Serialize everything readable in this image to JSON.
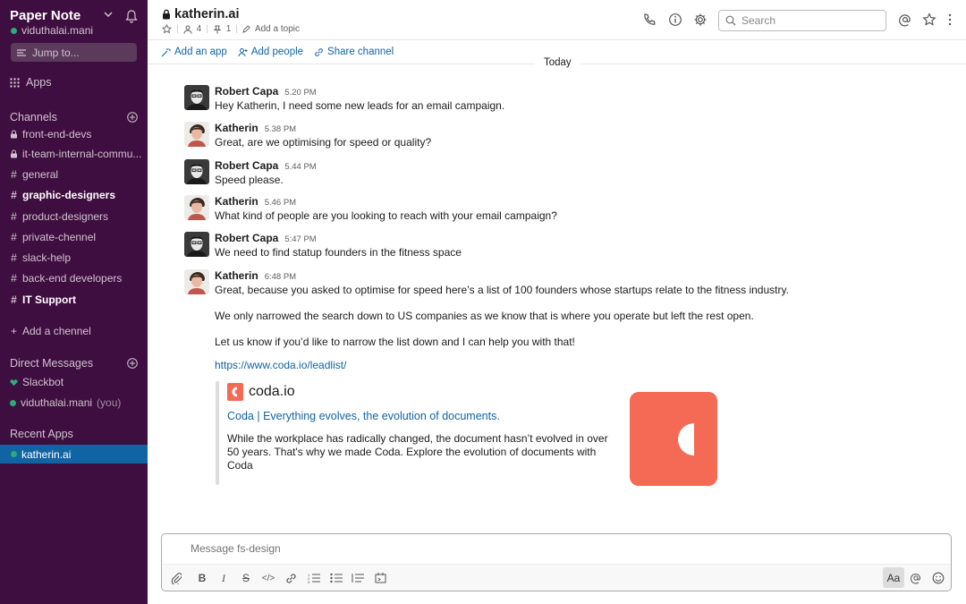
{
  "workspace": {
    "name": "Paper Note",
    "user": "viduthalai.mani"
  },
  "sidebar": {
    "jump_to": "Jump to...",
    "apps": "Apps",
    "channels_header": "Channels",
    "channels": [
      {
        "label": "front-end-devs",
        "locked": true,
        "bold": false
      },
      {
        "label": "it-team-internal-commu...",
        "locked": true,
        "bold": false
      },
      {
        "label": "general",
        "locked": false,
        "bold": false
      },
      {
        "label": "graphic-designers",
        "locked": false,
        "bold": true
      },
      {
        "label": "product-designers",
        "locked": false,
        "bold": false
      },
      {
        "label": "private-chennel",
        "locked": false,
        "bold": false
      },
      {
        "label": "slack-help",
        "locked": false,
        "bold": false
      },
      {
        "label": "back-end developers",
        "locked": false,
        "bold": false
      },
      {
        "label": "IT Support",
        "locked": false,
        "bold": true
      }
    ],
    "add_channel": "Add a chennel",
    "dm_header": "Direct Messages",
    "dms": [
      {
        "label": "Slackbot"
      },
      {
        "label": "viduthalai.mani",
        "suffix": "(you)"
      }
    ],
    "recent_apps_header": "Recent Apps",
    "recent_app": "katherin.ai"
  },
  "header": {
    "channel": "katherin.ai",
    "members": "4",
    "pins": "1",
    "topic": "Add a topic",
    "search_placeholder": "Search"
  },
  "subbar": {
    "add_app": "Add an app",
    "add_people": "Add people",
    "share": "Share channel"
  },
  "day_divider": "Today",
  "messages": [
    {
      "author": "Robert Capa",
      "time": "5.20 PM",
      "text": "Hey Katherin, I need some new leads  for an email campaign."
    },
    {
      "author": "Katherin",
      "time": "5.38 PM",
      "text": "Great, are we optimising for speed or quality?"
    },
    {
      "author": "Robert Capa",
      "time": "5.44 PM",
      "text": "Speed please."
    },
    {
      "author": "Katherin",
      "time": "5.46 PM",
      "text": "What kind of people are you looking  to reach with your email campaign?"
    },
    {
      "author": "Robert Capa",
      "time": "5:47 PM",
      "text": "We need to find statup founders in the fitness space"
    },
    {
      "author": "Katherin",
      "time": "6:48 PM",
      "text": "Great, because you asked to optimise for speed here’s a list of 100 founders  whose startups relate to the fitness industry."
    }
  ],
  "extra_paragraphs": [
    "We only narrowed the search down to US companies as we know that is where you operate but left the rest open.",
    "Let us know if you’d like to narrow the list down and I can help you with that!"
  ],
  "link_url": "https://www.coda.io/leadlist/",
  "attachment": {
    "brand": "coda.io",
    "title": "Coda | Everything evolves, the evolution of documents.",
    "description": "While the workplace has radically changed, the document hasn’t evolved in over 50 years. That's why we made Coda. Explore the evolution of documents with Coda"
  },
  "composer": {
    "placeholder": "Message fs-design",
    "format_label": "Aa"
  },
  "colors": {
    "sidebar": "#3f0e40",
    "active": "#1164a3",
    "link": "#1264a3",
    "coda": "#f46a54",
    "presence": "#2bac76"
  }
}
